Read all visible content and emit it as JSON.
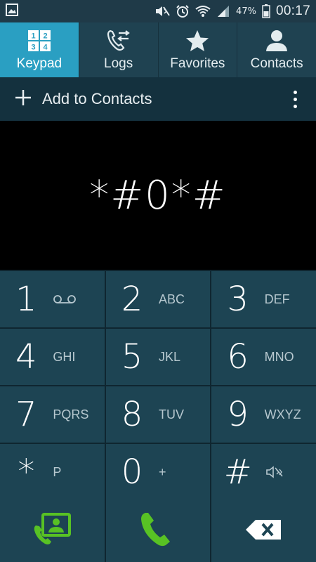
{
  "status_bar": {
    "battery_percent": "47%",
    "time": "00:17",
    "icons": [
      "picture-icon",
      "mute-icon",
      "alarm-icon",
      "wifi-icon",
      "signal-icon",
      "battery-icon"
    ]
  },
  "tabs": [
    {
      "label": "Keypad",
      "icon": "keypad-icon",
      "active": true
    },
    {
      "label": "Logs",
      "icon": "logs-icon",
      "active": false
    },
    {
      "label": "Favorites",
      "icon": "star-icon",
      "active": false
    },
    {
      "label": "Contacts",
      "icon": "person-icon",
      "active": false
    }
  ],
  "tab_icon_digits": [
    "1",
    "2",
    "3",
    "4"
  ],
  "action_bar": {
    "add_label": "Add to Contacts"
  },
  "display": {
    "number": "*#0*#"
  },
  "keys": [
    {
      "digit": "1",
      "letters": "",
      "icon": "voicemail-icon"
    },
    {
      "digit": "2",
      "letters": "ABC"
    },
    {
      "digit": "3",
      "letters": "DEF"
    },
    {
      "digit": "4",
      "letters": "GHI"
    },
    {
      "digit": "5",
      "letters": "JKL"
    },
    {
      "digit": "6",
      "letters": "MNO"
    },
    {
      "digit": "7",
      "letters": "PQRS"
    },
    {
      "digit": "8",
      "letters": "TUV"
    },
    {
      "digit": "9",
      "letters": "WXYZ"
    },
    {
      "digit": "*",
      "letters": "P"
    },
    {
      "digit": "0",
      "letters": "+"
    },
    {
      "digit": "#",
      "letters": "",
      "icon": "mute-icon"
    }
  ],
  "bottom": {
    "icons": [
      "contact-card-icon",
      "phone-call-icon",
      "backspace-icon"
    ]
  },
  "colors": {
    "active_tab": "#2a9fc2",
    "call_green": "#58c224",
    "key_bg": "#1d4453"
  }
}
